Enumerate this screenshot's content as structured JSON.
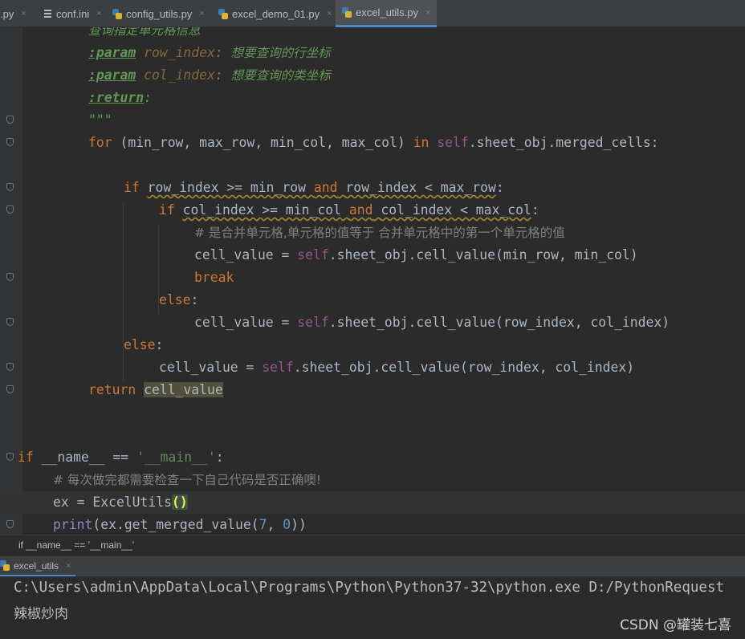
{
  "tabs": [
    {
      "label": ".py",
      "icon": "python-file-icon",
      "active": false
    },
    {
      "label": "conf.ini",
      "icon": "ini-file-icon",
      "active": false
    },
    {
      "label": "config_utils.py",
      "icon": "python-file-icon",
      "active": false
    },
    {
      "label": "excel_demo_01.py",
      "icon": "python-file-icon",
      "active": false
    },
    {
      "label": "excel_utils.py",
      "icon": "python-file-icon",
      "active": true
    }
  ],
  "tab_close_glyph": "×",
  "code": {
    "doc_title": "查询指定单元格信息",
    "param_tag": ":param",
    "return_tag": ":return",
    "param1_name": "row_index",
    "param1_desc": "想要查询的行坐标",
    "param2_name": "col_index",
    "param2_desc": "想要查询的类坐标",
    "docstring_close": "\"\"\"",
    "for_kw": "for",
    "for_vars": "(min_row, max_row, min_col, max_col)",
    "in_kw": "in",
    "self_kw": "self",
    "merged_attr": ".sheet_obj.merged_cells:",
    "if_kw": "if",
    "cond1_a": "row_index >= min_row",
    "and_kw": "and",
    "cond1_b": "row_index < max_row",
    "colon": ":",
    "cond2_a": "col_index >= min_col",
    "cond2_b": "col_index < max_col",
    "comment_merged": "# 是合并单元格,单元格的值等于 合并单元格中的第一个单元格的值",
    "assign_cell": "cell_value = ",
    "call_first": ".sheet_obj.cell_value(min_row, min_col)",
    "break_kw": "break",
    "else_kw": "else",
    "call_rc": ".sheet_obj.cell_value(row_index, col_index)",
    "return_kw": "return",
    "return_val": "cell_value",
    "main_name": "__name__ == ",
    "main_str": "'__main__'",
    "comment_check": "# 每次做完都需要检查一下自己代码是否正确噢!",
    "ex_assign": "ex = ExcelUtils",
    "paren_pair": "()",
    "print_kw": "print",
    "print_args_a": "(ex.get_merged_value(",
    "num_7": "7",
    "comma_sp": ", ",
    "num_0": "0",
    "print_args_b": "))"
  },
  "breadcrumb": "if __name__ == '__main__'",
  "run": {
    "tab_label": "excel_utils",
    "close_glyph": "×",
    "command": "C:\\Users\\admin\\AppData\\Local\\Programs\\Python\\Python37-32\\python.exe D:/PythonRequest",
    "output": "辣椒炒肉"
  },
  "watermark": "CSDN @罐装七喜"
}
